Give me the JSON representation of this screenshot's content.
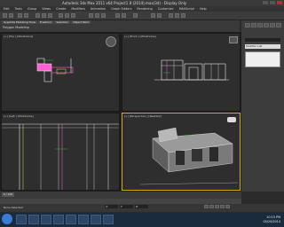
{
  "window": {
    "title": "Autodesk 3ds Max 2011 x64    Project1 8 (2014).max(3d) - Display Only"
  },
  "menu": [
    "Edit",
    "Tools",
    "Group",
    "Views",
    "Create",
    "Modifiers",
    "Animation",
    "Graph Editors",
    "Rendering",
    "Customize",
    "MAXScript",
    "Help"
  ],
  "ribbon": {
    "tabs": [
      "Graphite Modeling Tools",
      "Freeform",
      "Selection",
      "Object Paint"
    ],
    "panel_label": "Polygon Modeling"
  },
  "viewports": {
    "top": "[+] [Top ] [Wireframe]",
    "front": "[+] [Front ] [Wireframe]",
    "left": "[+] [Left ] [Wireframe]",
    "perspective": "[+] [Perspective ] [Realistic]"
  },
  "command_panel": {
    "field_label": "Modifier List"
  },
  "timeline": {
    "frame": "0 / 100"
  },
  "status": {
    "text": "None Selected",
    "x": "X:",
    "y": "Y:",
    "z": "Z:"
  },
  "clock": {
    "time": "10:15 PM",
    "date": "05/20/2014"
  },
  "colors": {
    "active_border": "#d4b000",
    "wire_white": "#e6e6e6",
    "wire_pink": "#ff5fd0",
    "wire_yellow": "#e8e050",
    "wire_green": "#33cc33"
  }
}
